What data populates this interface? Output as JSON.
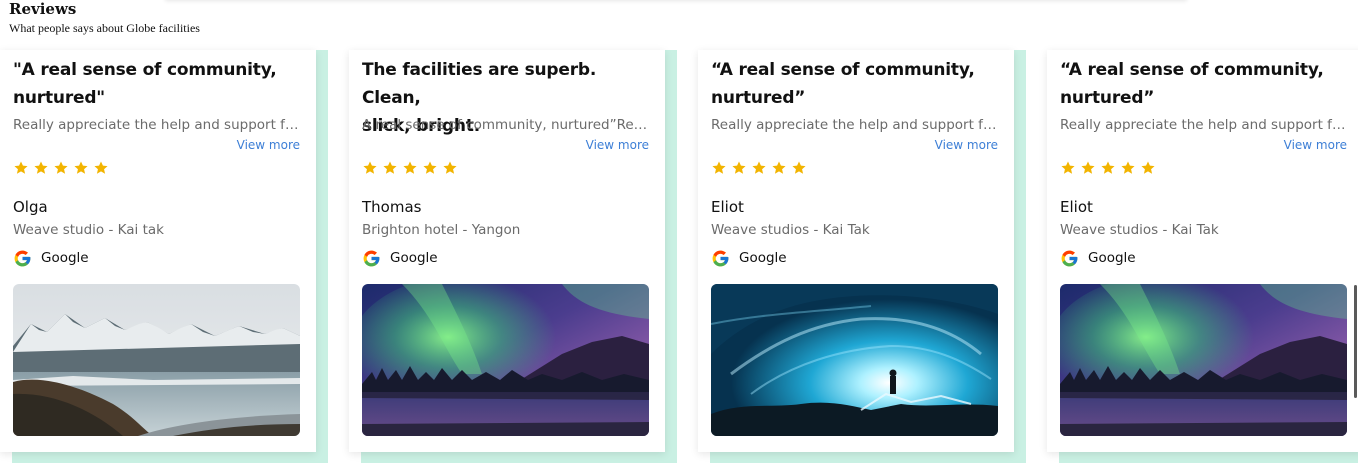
{
  "section": {
    "title": "Reviews",
    "subtitle": "What people says about Globe facilities"
  },
  "colors": {
    "accent": "#c9f0e3",
    "link": "#3d7fd6",
    "star": "#f2b400"
  },
  "reviews": [
    {
      "quote_line1": "\"A real sense of community,",
      "quote_line2": "nurtured\"",
      "snippet": "Really appreciate the help and support fro...",
      "view_more": "View more",
      "rating": 5,
      "name": "Olga",
      "location": "Weave studio - Kai tak",
      "source": "Google",
      "image": "mountain-lake-photo"
    },
    {
      "quote_line1": "The facilities are superb. Clean,",
      "quote_line2": "slick, bright.",
      "snippet": "A real sense of community, nurtured”Reall...",
      "view_more": "View more",
      "rating": 5,
      "name": "Thomas",
      "location": "Brighton hotel - Yangon",
      "source": "Google",
      "image": "aurora-photo"
    },
    {
      "quote_line1": "“A real sense of community,",
      "quote_line2": "nurtured”",
      "snippet": "Really appreciate the help and support fro...",
      "view_more": "View more",
      "rating": 5,
      "name": "Eliot",
      "location": "Weave studios - Kai Tak",
      "source": "Google",
      "image": "ice-cave-photo"
    },
    {
      "quote_line1": "“A real sense of community,",
      "quote_line2": "nurtured”",
      "snippet": "Really appreciate the help and support fro...",
      "view_more": "View more",
      "rating": 5,
      "name": "Eliot",
      "location": "Weave studios - Kai Tak",
      "source": "Google",
      "image": "aurora-photo"
    }
  ]
}
